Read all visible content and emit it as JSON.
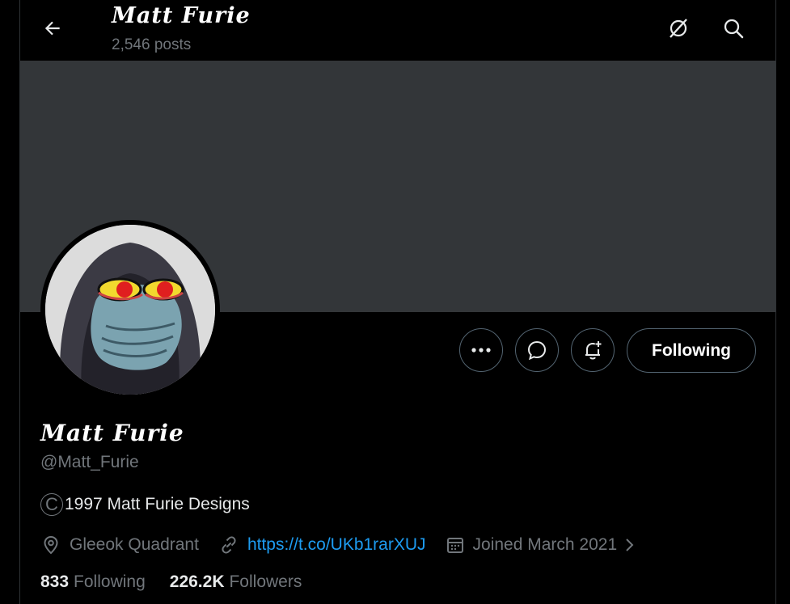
{
  "header": {
    "name": "Matt Furie",
    "posts_count": "2,546 posts",
    "icons": [
      "back-arrow-icon",
      "grok-icon",
      "search-icon"
    ]
  },
  "profile": {
    "display_name": "Matt Furie",
    "handle": "@Matt_Furie",
    "bio_symbol": "C",
    "bio_text": "1997 Matt Furie Designs",
    "location": "Gleeok Quadrant",
    "url": "https://t.co/UKb1rarXUJ",
    "joined": "Joined March 2021",
    "following_count": "833",
    "following_label": "Following",
    "followers_count": "226.2K",
    "followers_label": "Followers"
  },
  "actions": {
    "more_icon": "ellipsis-icon",
    "message_icon": "message-icon",
    "notify_icon": "bell-plus-icon",
    "following_button": "Following"
  },
  "colors": {
    "background": "#000000",
    "banner": "#333639",
    "link": "#1d9bf0",
    "muted": "#71767b"
  }
}
